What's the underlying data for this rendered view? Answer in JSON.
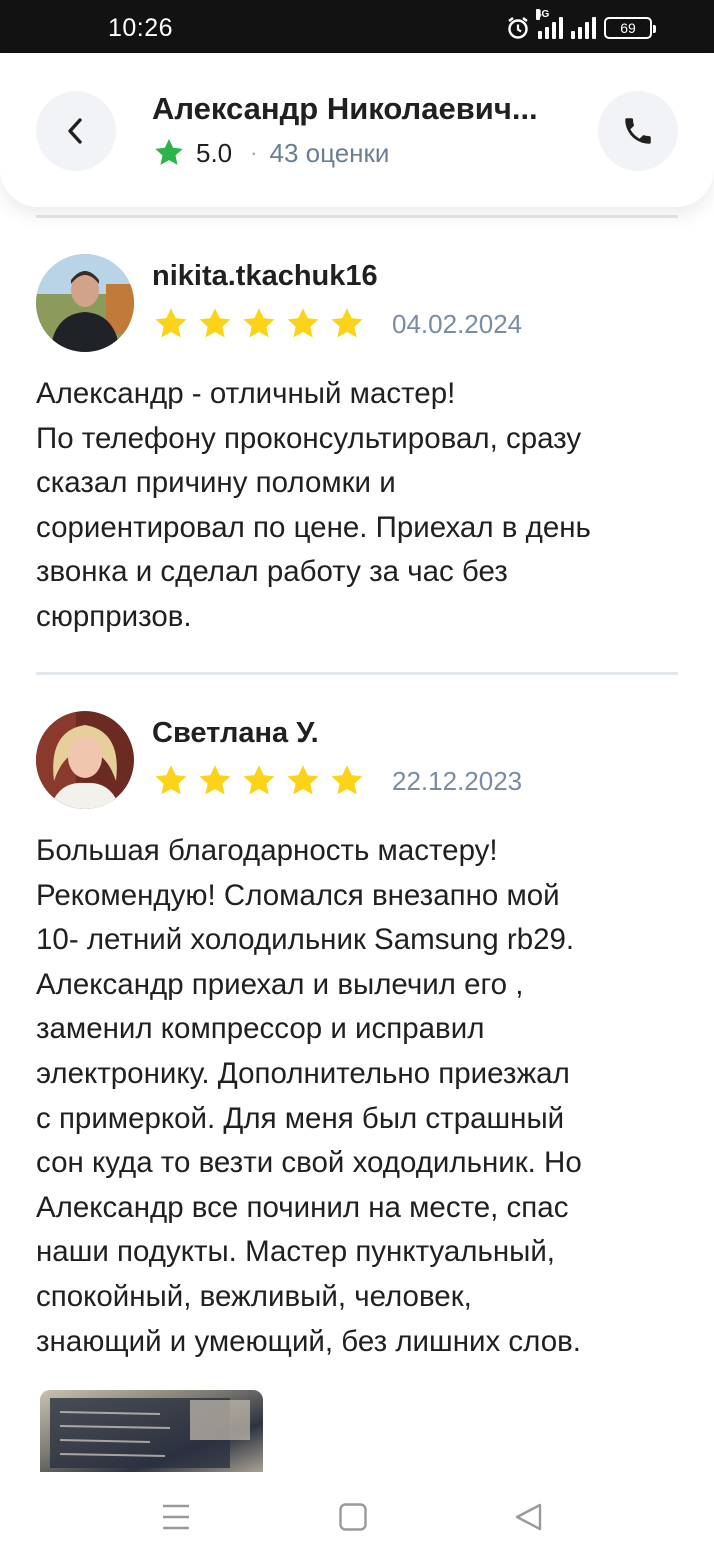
{
  "status_bar": {
    "time": "10:26",
    "network": "4G",
    "battery": "69"
  },
  "header": {
    "title": "Александр Николаевич...",
    "rating": "5.0",
    "separator": "·",
    "reviews_count": "43 оценки",
    "back_icon": "chevron-left-icon",
    "call_icon": "phone-icon"
  },
  "reviews": [
    {
      "author": "nikita.tkachuk16",
      "stars": 5,
      "date": "04.02.2024",
      "text_lines": [
        "Александр - отличный мастер!",
        "По телефону проконсультировал, сразу",
        "сказал причину поломки и",
        "сориентировал по цене. Приехал в день",
        "звонка и сделал работу за час без",
        "сюрпризов."
      ]
    },
    {
      "author": "Светлана У.",
      "stars": 5,
      "date": "22.12.2023",
      "text_lines": [
        "Большая благодарность мастеру!",
        "Рекомендую! Сломался внезапно мой",
        "10- летний холодильник Samsung rb29.",
        "Александр приехал и вылечил его ,",
        "заменил компрессор и исправил",
        "электронику. Дополнительно приезжал",
        "с примеркой. Для меня был страшный",
        "сон куда то везти свой хододильник. Но",
        "Александр все починил на месте, спас",
        "наши подукты. Мастер пунктуальный,",
        "спокойный, вежливый, человек,",
        "знающий и умеющий, без лишних слов."
      ]
    }
  ],
  "colors": {
    "star_green": "#2db34a",
    "star_yellow": "#fcd319",
    "muted_text": "#7a8da0"
  },
  "nav": {
    "menu_icon": "menu-icon",
    "home_icon": "home-square-icon",
    "back_icon": "back-triangle-icon"
  }
}
